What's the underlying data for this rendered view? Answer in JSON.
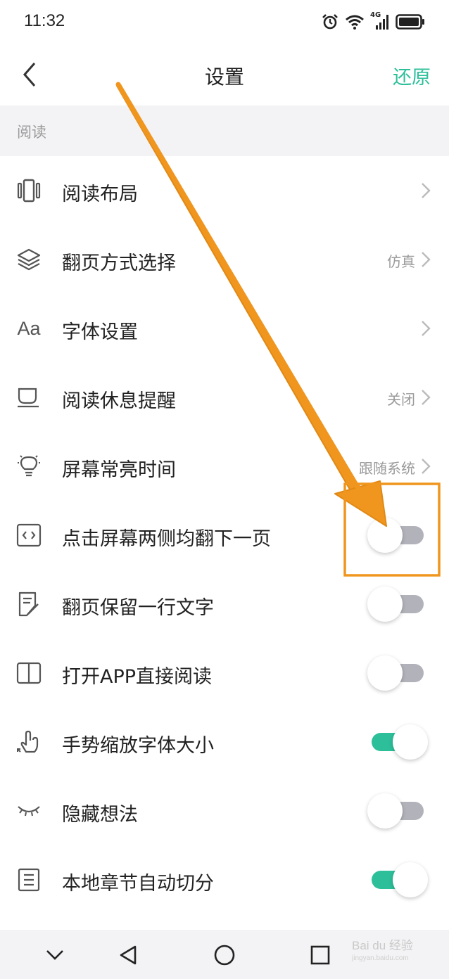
{
  "status_bar": {
    "time": "11:32",
    "icons": [
      "alarm-icon",
      "wifi-icon",
      "signal-4g-icon",
      "battery-icon"
    ],
    "network_label": "4G"
  },
  "header": {
    "back_icon": "chevron-left-icon",
    "title": "设置",
    "restore_label": "还原"
  },
  "section": {
    "title": "阅读"
  },
  "settings": [
    {
      "label": "阅读布局",
      "icon": "layout-icon",
      "control": "chevron",
      "value": ""
    },
    {
      "label": "翻页方式选择",
      "icon": "layers-icon",
      "control": "chevron",
      "value": "仿真"
    },
    {
      "label": "字体设置",
      "icon": "font-icon",
      "control": "chevron",
      "value": "",
      "icon_text": "Aa"
    },
    {
      "label": "阅读休息提醒",
      "icon": "cup-icon",
      "control": "chevron",
      "value": "关闭"
    },
    {
      "label": "屏幕常亮时间",
      "icon": "lightbulb-icon",
      "control": "chevron",
      "value": "跟随系统"
    },
    {
      "label": "点击屏幕两侧均翻下一页",
      "icon": "code-brackets-icon",
      "control": "toggle",
      "on": false
    },
    {
      "label": "翻页保留一行文字",
      "icon": "note-edit-icon",
      "control": "toggle",
      "on": false
    },
    {
      "label": "打开APP直接阅读",
      "icon": "book-open-icon",
      "control": "toggle",
      "on": false
    },
    {
      "label": "手势缩放字体大小",
      "icon": "gesture-pinch-icon",
      "control": "toggle",
      "on": true
    },
    {
      "label": "隐藏想法",
      "icon": "eye-closed-icon",
      "control": "toggle",
      "on": false
    },
    {
      "label": "本地章节自动切分",
      "icon": "list-doc-icon",
      "control": "toggle",
      "on": true
    }
  ],
  "nav_bar": {
    "icons": [
      "chevron-down-icon",
      "back-triangle-icon",
      "home-circle-icon",
      "recents-square-icon"
    ]
  },
  "colors": {
    "accent": "#2dbf9a",
    "toggle_off": "#b2b3ba",
    "annotation": "#f0961e",
    "section_bg": "#f3f3f5"
  },
  "watermark": {
    "text": "Bai du 经验",
    "url": "jingyan.baidu.com"
  }
}
